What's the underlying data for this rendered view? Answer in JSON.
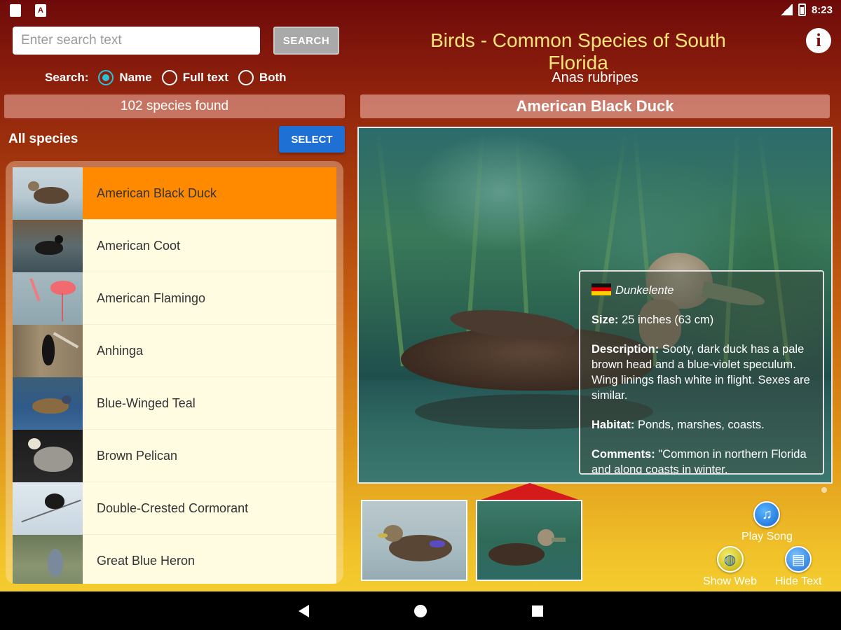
{
  "status_bar": {
    "time": "8:23",
    "left_icon_2": "A"
  },
  "search": {
    "placeholder": "Enter search text",
    "button_label": "SEARCH"
  },
  "search_mode": {
    "label": "Search:",
    "options": [
      {
        "label": "Name",
        "checked": true
      },
      {
        "label": "Full text",
        "checked": false
      },
      {
        "label": "Both",
        "checked": false
      }
    ]
  },
  "found_text": "102 species found",
  "list_header": {
    "title": "All species",
    "select_label": "SELECT"
  },
  "species": [
    {
      "name": "American Black Duck",
      "selected": true
    },
    {
      "name": "American Coot"
    },
    {
      "name": "American Flamingo"
    },
    {
      "name": "Anhinga"
    },
    {
      "name": "Blue-Winged Teal"
    },
    {
      "name": "Brown Pelican"
    },
    {
      "name": "Double-Crested Cormorant"
    },
    {
      "name": "Great Blue Heron"
    }
  ],
  "app_title": "Birds - Common Species of South Florida",
  "detail": {
    "scientific_name": "Anas rubripes",
    "common_name": "American Black Duck",
    "german_name": "Dunkelente",
    "size_label": "Size:",
    "size_value": " 25 inches (63 cm)",
    "description_label": "Description:",
    "description_value": " Sooty, dark duck has a pale brown head and a blue-violet speculum. Wing linings flash white in flight. Sexes are similar.",
    "habitat_label": "Habitat:",
    "habitat_value": " Ponds, marshes, coasts.",
    "comments_label": "Comments:",
    "comments_value": " \"Common in northern Florida and along coasts in winter."
  },
  "actions": {
    "play_song": "Play Song",
    "show_web": "Show Web",
    "hide_text": "Hide Text"
  },
  "colors": {
    "selected_item": "#ff8a00",
    "select_button": "#1e70d4",
    "title_text": "#ffe47a",
    "radio_checked": "#2bc0d6"
  }
}
